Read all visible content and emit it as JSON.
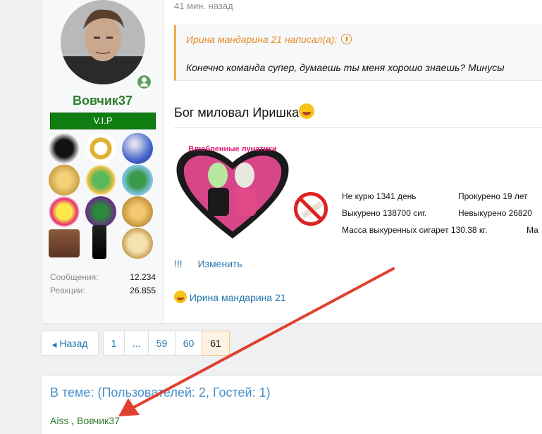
{
  "post": {
    "username": "Вовчик37",
    "rank_badge": "V.I.P",
    "stats": [
      {
        "label": "Сообщения:",
        "value": "12.234"
      },
      {
        "label": "Реакции:",
        "value": "26.855"
      }
    ],
    "time_ago": "41 мин. назад",
    "quote": {
      "author_line": "Ирина мандарина 21 написал(а):",
      "text": "Конечно команда супер, думаешь ты меня хорошо знаешь? Минусы"
    },
    "message_text": "Бог миловал Иришка",
    "signature_image_text": "Влюбленные лунатики",
    "smoke_stats": {
      "row1_left": "Не курю 1341 день",
      "row1_right": "Прокурено 19 лет",
      "row2_left": "Выкурено 138700 сиг.",
      "row2_right": "Невыкурено 26820",
      "row3_left": "Масса выкуренных сигарет 130.38 кг.",
      "row3_right": "Ма"
    },
    "actions": {
      "bang": "!!!",
      "edit": "Изменить"
    },
    "likes": "Ирина мандарина 21"
  },
  "pagination": {
    "back": "Назад",
    "pages": [
      "1",
      "...",
      "59",
      "60",
      "61"
    ],
    "current": "61"
  },
  "online": {
    "title": "В теме: (Пользователей: 2, Гостей: 1)",
    "user1": "Aiss",
    "separator": ",",
    "user2": "Вовчик37"
  },
  "colors": {
    "accent": "#2577b1",
    "username_green": "#2f7d2f",
    "quote_orange": "#e58e28",
    "vip_green": "#0f7d10",
    "arrow_red": "#e04030"
  }
}
